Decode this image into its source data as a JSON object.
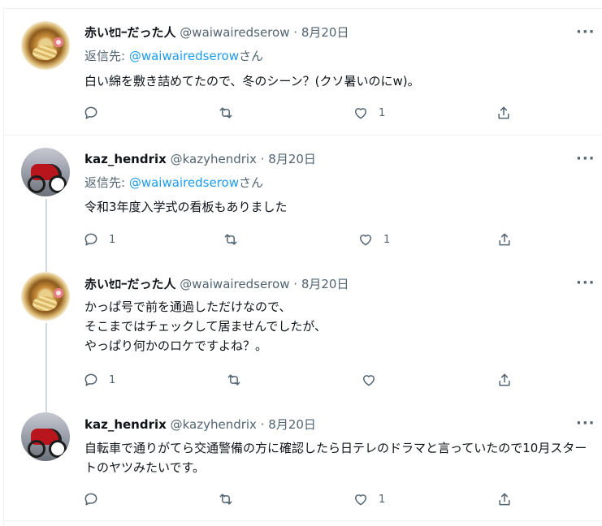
{
  "tweets": [
    {
      "name": "赤いｾﾛｰだった人",
      "handle": "@waiwairedserow",
      "separator": "·",
      "date": "8月20日",
      "reply_prefix": "返信先: ",
      "reply_mention": "@waiwairedserow",
      "reply_suffix": "さん",
      "text": "白い綿を敷き詰めてたので、冬のシーン？(クソ暑いのにw)。",
      "reply_count": "",
      "retweet_count": "",
      "like_count": "1",
      "avatar": "ramen-avatar"
    },
    {
      "name": "kaz_hendrix",
      "handle": "@kazyhendrix",
      "separator": "·",
      "date": "8月20日",
      "reply_prefix": "返信先: ",
      "reply_mention": "@waiwairedserow",
      "reply_suffix": "さん",
      "text": "令和3年度入学式の看板もありました",
      "reply_count": "1",
      "retweet_count": "",
      "like_count": "1",
      "avatar": "motorcycle-avatar"
    },
    {
      "name": "赤いｾﾛｰだった人",
      "handle": "@waiwairedserow",
      "separator": "·",
      "date": "8月20日",
      "text": "かっぱ号で前を通過しただけなので、\nそこまではチェックして居ませんでしたが、\nやっぱり何かのロケですよね？。",
      "reply_count": "1",
      "retweet_count": "",
      "like_count": "",
      "avatar": "ramen-avatar"
    },
    {
      "name": "kaz_hendrix",
      "handle": "@kazyhendrix",
      "separator": "·",
      "date": "8月20日",
      "text": "自転車で通りがてら交通警備の方に確認したら日テレのドラマと言っていたので10月スタートのヤツみたいです。",
      "reply_count": "",
      "retweet_count": "",
      "like_count": "1",
      "avatar": "motorcycle-avatar"
    }
  ],
  "more_glyph": "···",
  "icons": [
    "reply-icon",
    "retweet-icon",
    "like-icon",
    "share-icon",
    "more-icon"
  ],
  "colors": {
    "link": "#1d9bf0",
    "secondary": "#536471",
    "text": "#0f1419",
    "thread_line": "#cfd9de"
  }
}
